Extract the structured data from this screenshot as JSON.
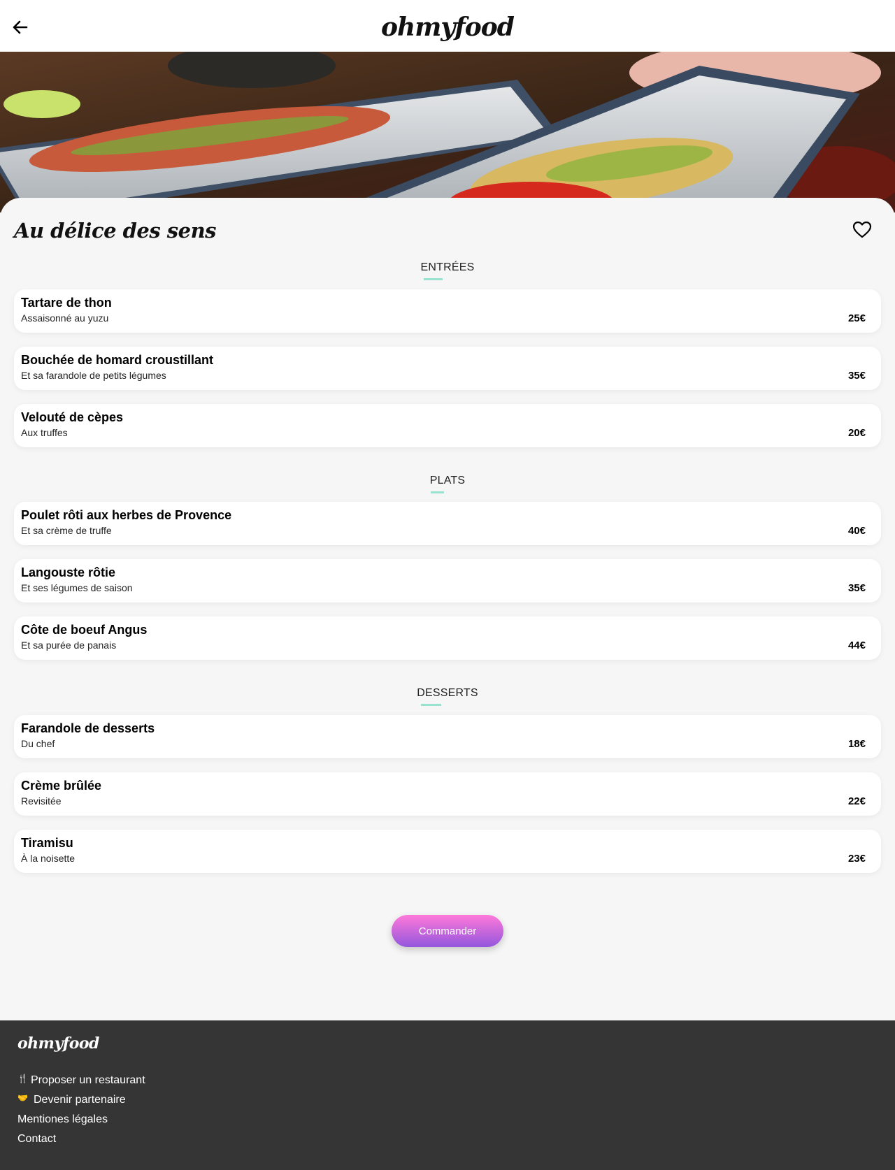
{
  "header": {
    "logo": "ohmyfood",
    "back_icon": "arrow-left-icon"
  },
  "restaurant": {
    "name": "Au délice des sens",
    "favorite_icon": "heart-outline-icon"
  },
  "sections": [
    {
      "title": "ENTRÉES",
      "dishes": [
        {
          "name": "Tartare de thon",
          "desc": "Assaisonné au yuzu",
          "price": "25€"
        },
        {
          "name": "Bouchée de homard croustillant",
          "desc": "Et sa farandole de petits légumes",
          "price": "35€"
        },
        {
          "name": "Velouté de cèpes",
          "desc": "Aux truffes",
          "price": "20€"
        }
      ]
    },
    {
      "title": "PLATS",
      "dishes": [
        {
          "name": "Poulet rôti aux herbes de Provence",
          "desc": "Et sa crème de truffe",
          "price": "40€"
        },
        {
          "name": "Langouste rôtie",
          "desc": "Et ses légumes de saison",
          "price": "35€"
        },
        {
          "name": "Côte de boeuf Angus",
          "desc": "Et sa purée de panais",
          "price": "44€"
        }
      ]
    },
    {
      "title": "DESSERTS",
      "dishes": [
        {
          "name": "Farandole de desserts",
          "desc": "Du chef",
          "price": "18€"
        },
        {
          "name": "Crème brûlée",
          "desc": "Revisitée",
          "price": "22€"
        },
        {
          "name": "Tiramisu",
          "desc": "À la noisette",
          "price": "23€"
        }
      ]
    }
  ],
  "order_button": "Commander",
  "footer": {
    "logo": "ohmyfood",
    "links": [
      {
        "label": "Proposer un restaurant",
        "icon": "utensils-icon"
      },
      {
        "label": "Devenir partenaire",
        "icon": "handshake-icon"
      },
      {
        "label": "Mentiones légales"
      },
      {
        "label": "Contact"
      }
    ]
  },
  "colors": {
    "accent_bar": "#99e2d0",
    "button_top": "#ff79da",
    "button_bottom": "#9356dc",
    "footer_bg": "#353535"
  }
}
